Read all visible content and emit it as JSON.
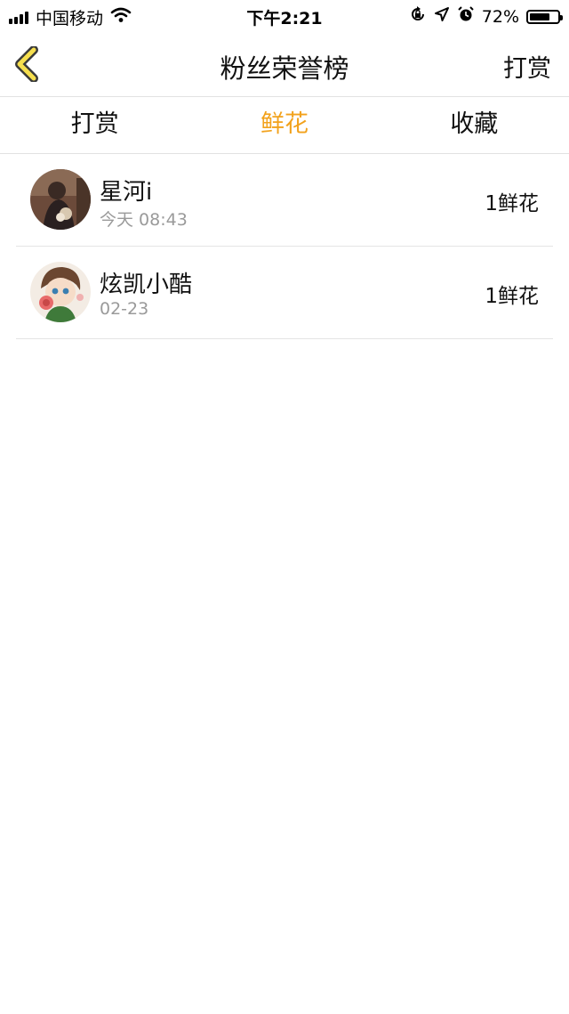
{
  "status_bar": {
    "carrier": "中国移动",
    "time": "下午2:21",
    "battery_percent": "72%",
    "battery_level": 0.72,
    "icons": [
      "signal-icon",
      "wifi-icon",
      "orientation-lock-icon",
      "location-icon",
      "alarm-icon",
      "battery-icon"
    ]
  },
  "nav": {
    "title": "粉丝荣誉榜",
    "right_label": "打赏",
    "back_icon": "chevron-left-icon",
    "accent": "#f2a21c"
  },
  "tabs": [
    {
      "label": "打赏",
      "active": false
    },
    {
      "label": "鲜花",
      "active": true
    },
    {
      "label": "收藏",
      "active": false
    }
  ],
  "fans": [
    {
      "name": "星河i",
      "time": "今天 08:43",
      "gift": "1鲜花"
    },
    {
      "name": "炫凯小酷",
      "time": "02-23",
      "gift": "1鲜花"
    }
  ]
}
